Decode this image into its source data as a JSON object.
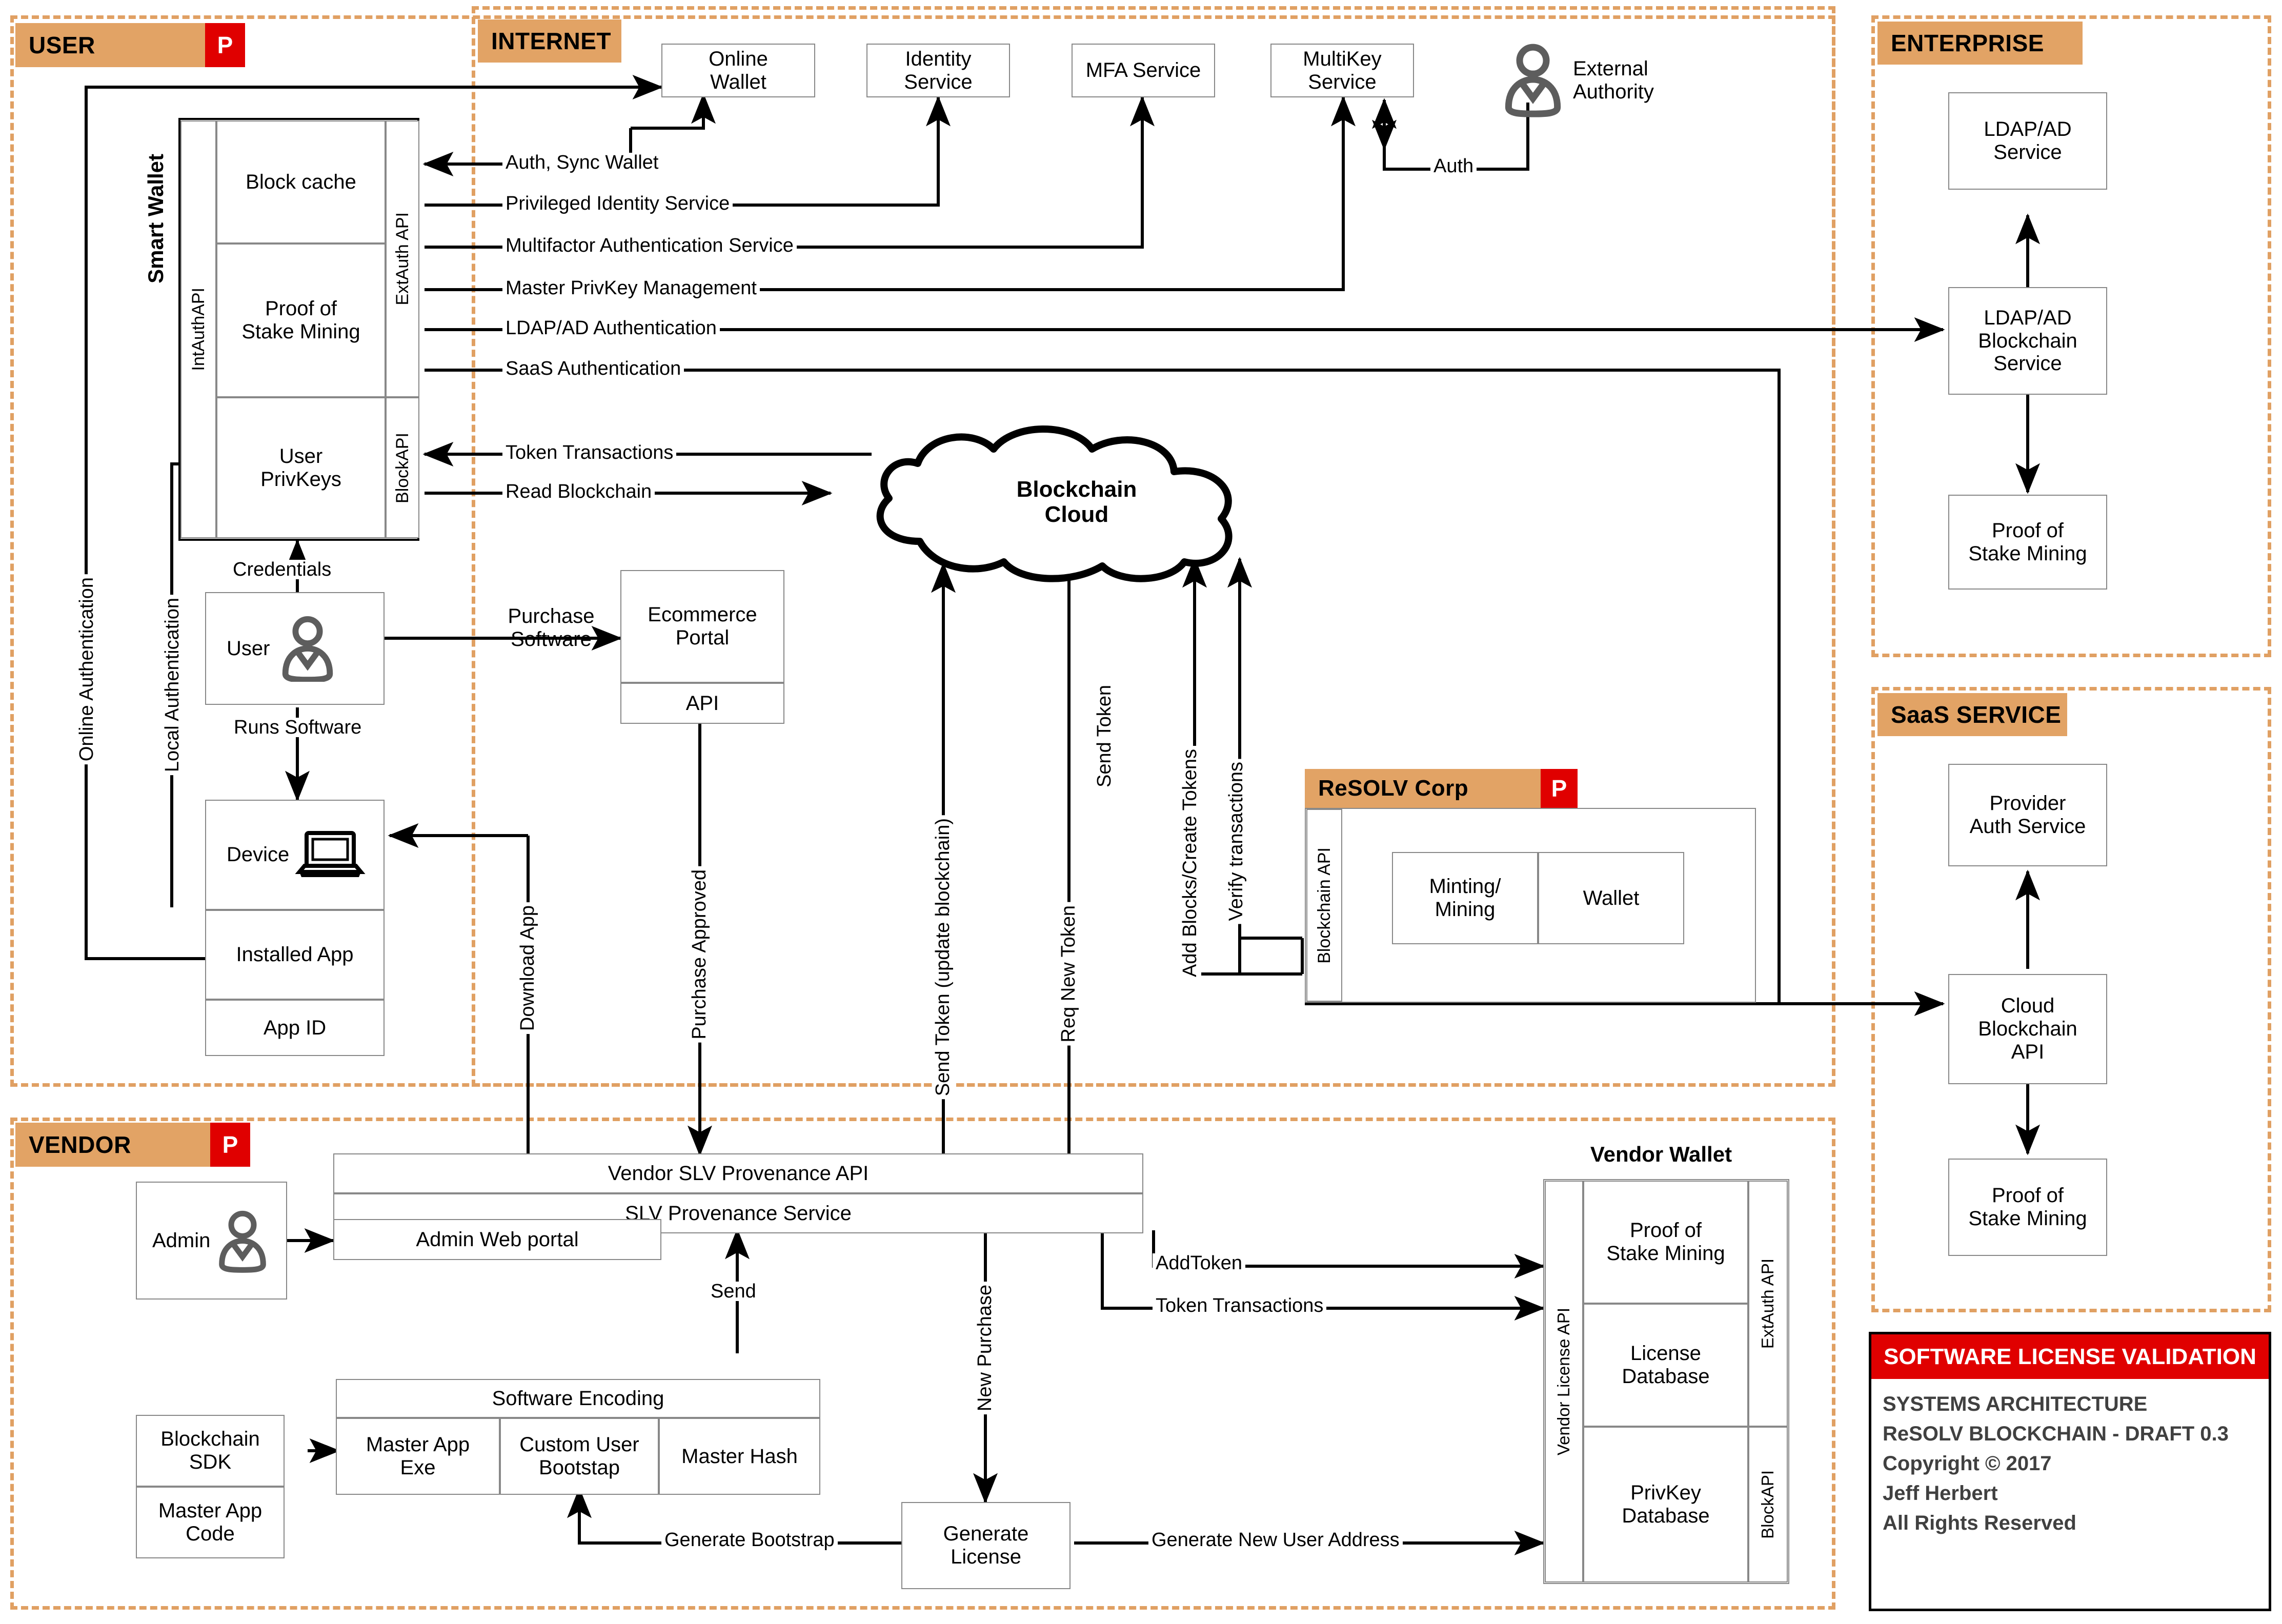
{
  "zones": {
    "user": {
      "label": "USER",
      "badge": "P"
    },
    "internet": {
      "label": "INTERNET"
    },
    "enterprise": {
      "label": "ENTERPRISE"
    },
    "saas": {
      "label": "SaaS SERVICE"
    },
    "vendor": {
      "label": "VENDOR",
      "badge": "P"
    },
    "resolv": {
      "label": "ReSOLV Corp",
      "badge": "P"
    }
  },
  "user_zone": {
    "smart_wallet_title": "Smart Wallet",
    "int_auth_api": "IntAuthAPI",
    "ext_auth_api": "ExtAuth API",
    "block_api": "BlockAPI",
    "block_cache": "Block cache",
    "proof_of_stake_mining": "Proof of\nStake Mining",
    "user_privkeys": "User\nPrivKeys",
    "user_box": "User",
    "device_box": "Device",
    "installed_app": "Installed App",
    "app_id": "App ID",
    "credentials": "Credentials",
    "runs_software": "Runs Software",
    "online_authentication": "Online Authentication",
    "local_authentication": "Local Authentication"
  },
  "internet_zone": {
    "online_wallet": "Online\nWallet",
    "identity_service": "Identity\nService",
    "mfa_service": "MFA Service",
    "multikey_service": "MultiKey\nService",
    "external_authority": "External\nAuthority",
    "auth": "Auth",
    "blockchain_cloud": "Blockchain\nCloud",
    "ecommerce_portal": "Ecommerce\nPortal",
    "ecommerce_api": "API",
    "purchase_software": "Purchase\nSoftware"
  },
  "wallet_lines": [
    "Auth, Sync Wallet",
    "Privileged Identity Service",
    "Multifactor Authentication Service",
    "Master PrivKey Management",
    "LDAP/AD Authentication",
    "SaaS Authentication",
    "Token Transactions",
    "Read Blockchain"
  ],
  "vertical_labels": {
    "download_app": "Download App",
    "purchase_approved": "Purchase Approved",
    "send_token_update": "Send Token (update blockchain)",
    "req_new_token": "Req New Token",
    "send_token": "Send Token",
    "add_blocks_create_tokens": "Add Blocks/Create Tokens",
    "verify_transactions": "Verify transactions",
    "new_purchase": "New Purchase",
    "send": "Send"
  },
  "resolv_zone": {
    "blockchain_api": "Blockchain API",
    "minting_mining": "Minting/\nMining",
    "wallet": "Wallet"
  },
  "enterprise_zone": {
    "ldap_ad_service": "LDAP/AD\nService",
    "ldap_ad_blockchain_service": "LDAP/AD\nBlockchain\nService",
    "proof_of_stake_mining": "Proof of\nStake Mining"
  },
  "saas_zone": {
    "provider_auth_service": "Provider\nAuth Service",
    "cloud_blockchain_api": "Cloud\nBlockchain\nAPI",
    "proof_of_stake_mining": "Proof of\nStake Mining"
  },
  "vendor_zone": {
    "admin": "Admin",
    "vendor_slv_provenance_api": "Vendor SLV Provenance API",
    "slv_provenance_service": "SLV Provenance Service",
    "admin_web_portal": "Admin Web portal",
    "software_encoding": "Software Encoding",
    "master_app_exe": "Master App\nExe",
    "custom_user_bootstap": "Custom User\nBootstap",
    "master_hash": "Master Hash",
    "blockchain_sdk": "Blockchain\nSDK",
    "master_app_code": "Master App\nCode",
    "generate_license": "Generate\nLicense",
    "generate_bootstrap": "Generate  Bootstrap",
    "generate_new_user_address": "Generate New User Address",
    "addtoken": "AddToken",
    "token_transactions": "Token Transactions",
    "vendor_wallet_title": "Vendor Wallet",
    "vendor_license_api": "Vendor License API",
    "ext_auth_api": "ExtAuth API",
    "block_api": "BlockAPI",
    "proof_of_stake_mining": "Proof of\nStake Mining",
    "license_database": "License\nDatabase",
    "privkey_database": "PrivKey\nDatabase"
  },
  "title_block": {
    "heading": "SOFTWARE LICENSE VALIDATION",
    "line1": "SYSTEMS ARCHITECTURE",
    "line2": "ReSOLV BLOCKCHAIN - DRAFT 0.3",
    "line3": "Copyright © 2017",
    "line4": "Jeff Herbert",
    "line5": "All Rights Reserved"
  },
  "colors": {
    "zone_border": "#E0A063",
    "zone_header": "#E2A365",
    "badge_red": "#E00000",
    "stroke": "#000000"
  }
}
